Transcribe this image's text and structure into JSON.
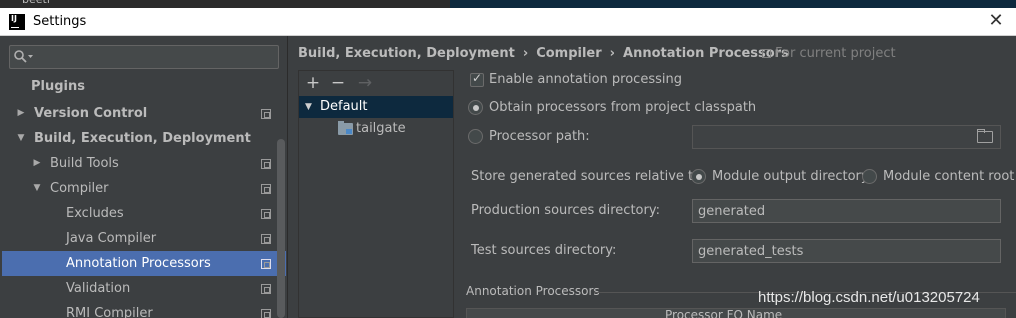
{
  "under_window": {
    "ghost_text": "beetl"
  },
  "window": {
    "title": "Settings",
    "close_glyph": "✕"
  },
  "search": {
    "value": ""
  },
  "tree": [
    {
      "label": "Plugins",
      "bold": true,
      "arrow": ""
    },
    {
      "label": "Version Control",
      "bold": true,
      "arrow": "▶"
    },
    {
      "label": "Build, Execution, Deployment",
      "bold": true,
      "arrow": "▼"
    },
    {
      "label": "Build Tools",
      "bold": false,
      "arrow": "▶"
    },
    {
      "label": "Compiler",
      "bold": false,
      "arrow": "▼"
    },
    {
      "label": "Excludes",
      "bold": false,
      "arrow": ""
    },
    {
      "label": "Java Compiler",
      "bold": false,
      "arrow": ""
    },
    {
      "label": "Annotation Processors",
      "bold": false,
      "arrow": "",
      "selected": true
    },
    {
      "label": "Validation",
      "bold": false,
      "arrow": ""
    },
    {
      "label": "RMI Compiler",
      "bold": false,
      "arrow": ""
    }
  ],
  "breadcrumb": {
    "items": [
      "Build, Execution, Deployment",
      "Compiler",
      "Annotation Processors"
    ],
    "separator": "›",
    "scope_note": "For current project"
  },
  "profiles": {
    "toolbar": {
      "add": "+",
      "remove": "−",
      "move": "→"
    },
    "items": [
      {
        "label": "Default",
        "arrow": "▼",
        "selected": true
      },
      {
        "label": "tailgate",
        "icon": "module-folder-icon"
      }
    ]
  },
  "form": {
    "enable_processing": {
      "label": "Enable annotation processing",
      "checked": true
    },
    "obtain_from_classpath": {
      "label": "Obtain processors from project classpath",
      "selected": true
    },
    "processor_path": {
      "label": "Processor path:",
      "selected": false,
      "value": ""
    },
    "store_relative": {
      "label": "Store generated sources relative to:",
      "options": [
        {
          "label": "Module output directory",
          "selected": true
        },
        {
          "label": "Module content root",
          "selected": false
        }
      ]
    },
    "production_dir": {
      "label": "Production sources directory:",
      "value": "generated"
    },
    "test_dir": {
      "label": "Test sources directory:",
      "value": "generated_tests"
    }
  },
  "annotation_processors": {
    "section_title": "Annotation Processors",
    "column_header": "Processor FQ Name"
  },
  "watermark": "https://blog.csdn.net/u013205724",
  "colors": {
    "background": "#3c3f41",
    "selection": "#4b6eaf",
    "profile_selection": "#0d293e",
    "text": "#bbbbbb"
  }
}
